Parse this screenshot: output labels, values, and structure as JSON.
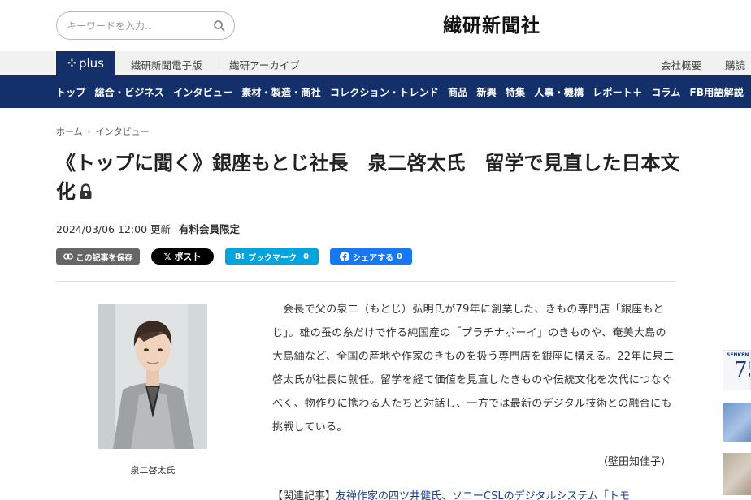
{
  "header": {
    "search_placeholder": "キーワードを入力..",
    "logo": "繊研新聞社"
  },
  "sub_bar": {
    "plus_label": "plus",
    "links": [
      "繊研新聞電子版",
      "繊研アーカイブ"
    ],
    "right_links": [
      "会社概要",
      "購読"
    ]
  },
  "nav": {
    "items": [
      "トップ",
      "総合・ビジネス",
      "インタビュー",
      "素材・製造・商社",
      "コレクション・トレンド",
      "商品",
      "新興",
      "特集",
      "人事・機構",
      "レポート＋",
      "コラム",
      "FB用語解説"
    ]
  },
  "breadcrumb": [
    "ホーム",
    "インタビュー"
  ],
  "article": {
    "title": "《トップに聞く》銀座もとじ社長　泉二啓太氏　留学で見直した日本文化",
    "date": "2024/03/06 12:00",
    "updated_label": "更新",
    "members_label": "有料会員限定",
    "photo_caption": "泉二啓太氏",
    "body": "会長で父の泉二（もとじ）弘明氏が79年に創業した、きもの専門店「銀座もとじ」。雄の蚕の糸だけで作る純国産の「プラチナボーイ」のきものや、奄美大島の大島紬など、全国の産地や作家のきものを扱う専門店を銀座に構える。22年に泉二啓太氏が社長に就任。留学を経て価値を見直したきものや伝統文化を次代につなぐべく、物作りに携わる人たちと対話し、一方では最新のデジタル技術との融合にも挑戦している。",
    "reporter": "（壁田知佳子）",
    "related_label": "【関連記事】",
    "related_link": "友禅作家の四ツ井健氏、ソニーCSLのデジタルシステム「トモ"
  },
  "share": {
    "save": "この記事を保存",
    "x_post": "ポスト",
    "hatena": "ブックマーク",
    "hatena_count": "0",
    "facebook": "シェアする",
    "facebook_count": "0"
  },
  "side_banner": {
    "small_text": "SENKEN",
    "number": "75"
  },
  "colors": {
    "navy": "#14306a",
    "hatena": "#00a4de",
    "facebook": "#1877f2"
  }
}
